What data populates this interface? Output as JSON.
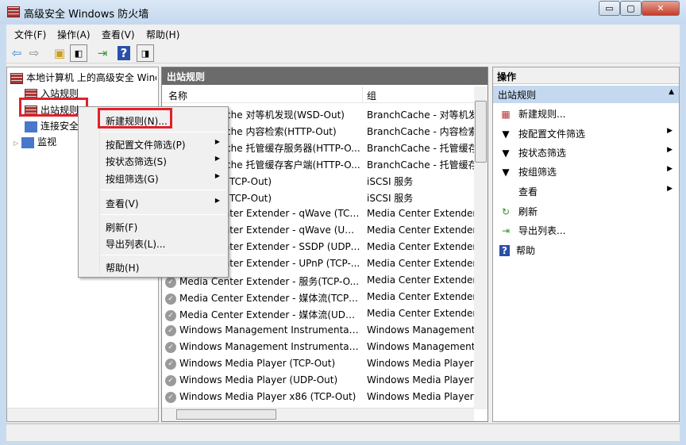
{
  "window": {
    "title": "高级安全 Windows 防火墙",
    "min": "▭",
    "max": "▢",
    "close": "✕"
  },
  "menu": [
    "文件(F)",
    "操作(A)",
    "查看(V)",
    "帮助(H)"
  ],
  "tree": {
    "root": "本地计算机 上的高级安全 Windows 防火墙",
    "items": [
      "入站规则",
      "出站规则",
      "连接安全规则",
      "监视"
    ]
  },
  "center": {
    "title": "出站规则",
    "columns": [
      "名称",
      "组"
    ],
    "rows": [
      [
        "BranchCache 对等机发现(WSD-Out)",
        "BranchCache - 对等机发现"
      ],
      [
        "BranchCache 内容检索(HTTP-Out)",
        "BranchCache - 内容检索"
      ],
      [
        "BranchCache 托管缓存服务器(HTTP-O...",
        "BranchCache - 托管缓存"
      ],
      [
        "BranchCache 托管缓存客户端(HTTP-O...",
        "BranchCache - 托管缓存"
      ],
      [
        "iSCSI 服务(TCP-Out)",
        "iSCSI 服务"
      ],
      [
        "iSCSI 服务(TCP-Out)",
        "iSCSI 服务"
      ],
      [
        "Media Center Extender - qWave (TCP...",
        "Media Center Extender"
      ],
      [
        "Media Center Extender - qWave (UD...",
        "Media Center Extender"
      ],
      [
        "Media Center Extender - SSDP (UDP-...",
        "Media Center Extender"
      ],
      [
        "Media Center Extender - UPnP (TCP-...",
        "Media Center Extender"
      ],
      [
        "Media Center Extender - 服务(TCP-O...",
        "Media Center Extender"
      ],
      [
        "Media Center Extender - 媒体流(TCP-...",
        "Media Center Extender"
      ],
      [
        "Media Center Extender - 媒体流(UDP-...",
        "Media Center Extender"
      ],
      [
        "Windows Management Instrumentati...",
        "Windows Management"
      ],
      [
        "Windows Management Instrumentati...",
        "Windows Management"
      ],
      [
        "Windows Media Player (TCP-Out)",
        "Windows Media Player"
      ],
      [
        "Windows Media Player (UDP-Out)",
        "Windows Media Player"
      ],
      [
        "Windows Media Player x86 (TCP-Out)",
        "Windows Media Player"
      ]
    ]
  },
  "context_menu": {
    "new_rule": "新建规则(N)...",
    "filter_profile": "按配置文件筛选(P)",
    "filter_state": "按状态筛选(S)",
    "filter_group": "按组筛选(G)",
    "view": "查看(V)",
    "refresh": "刷新(F)",
    "export": "导出列表(L)...",
    "help": "帮助(H)"
  },
  "actions": {
    "header": "操作",
    "section": "出站规则",
    "items": [
      "新建规则...",
      "按配置文件筛选",
      "按状态筛选",
      "按组筛选",
      "查看",
      "刷新",
      "导出列表...",
      "帮助"
    ]
  }
}
